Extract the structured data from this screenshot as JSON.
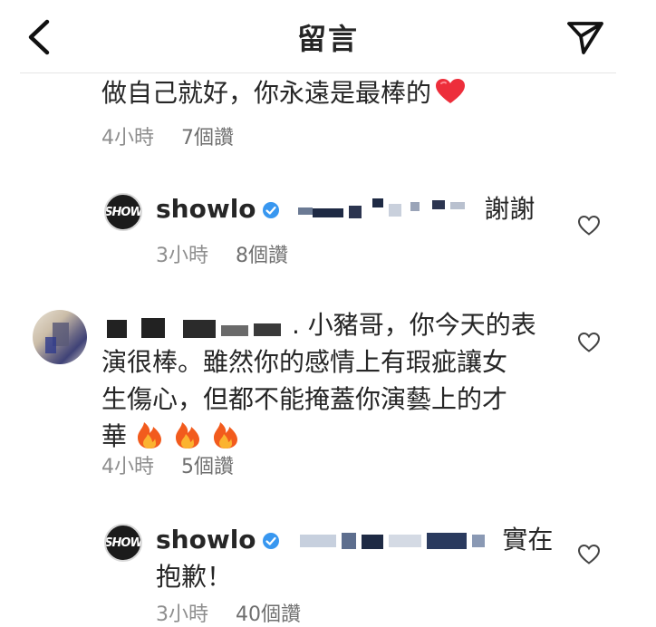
{
  "header": {
    "title": "留言"
  },
  "comments": [
    {
      "text": "做自己就好，你永遠是最棒的",
      "emoji": "❤️",
      "time": "4小時",
      "likes": "7個讚"
    },
    {
      "username": "showlo",
      "avatar_text": "SHOW",
      "reply_text": "謝謝",
      "time": "3小時",
      "likes": "8個讚"
    },
    {
      "text_line1_tail": ". 小豬哥，你今天的表",
      "text_line2": "演很棒。雖然你的感情上有瑕疵讓女",
      "text_line3": "生傷心，但都不能掩蓋你演藝上的才",
      "text_line4": "華",
      "emoji": "🔥 🔥 🔥",
      "time": "4小時",
      "likes": "5個讚"
    },
    {
      "username": "showlo",
      "avatar_text": "SHOW",
      "reply_text": "實在",
      "reply_text_line2": "抱歉！",
      "time": "3小時",
      "likes": "40個讚"
    }
  ],
  "colors": {
    "text": "#262626",
    "meta": "#8e8e8e",
    "verified": "#3897f0",
    "heart_red": "#ed2e3b",
    "fire": "#f58a1f"
  },
  "icons": [
    "back-chevron-icon",
    "send-icon",
    "verified-badge-icon",
    "heart-outline-icon",
    "red-heart-emoji",
    "fire-emoji"
  ]
}
